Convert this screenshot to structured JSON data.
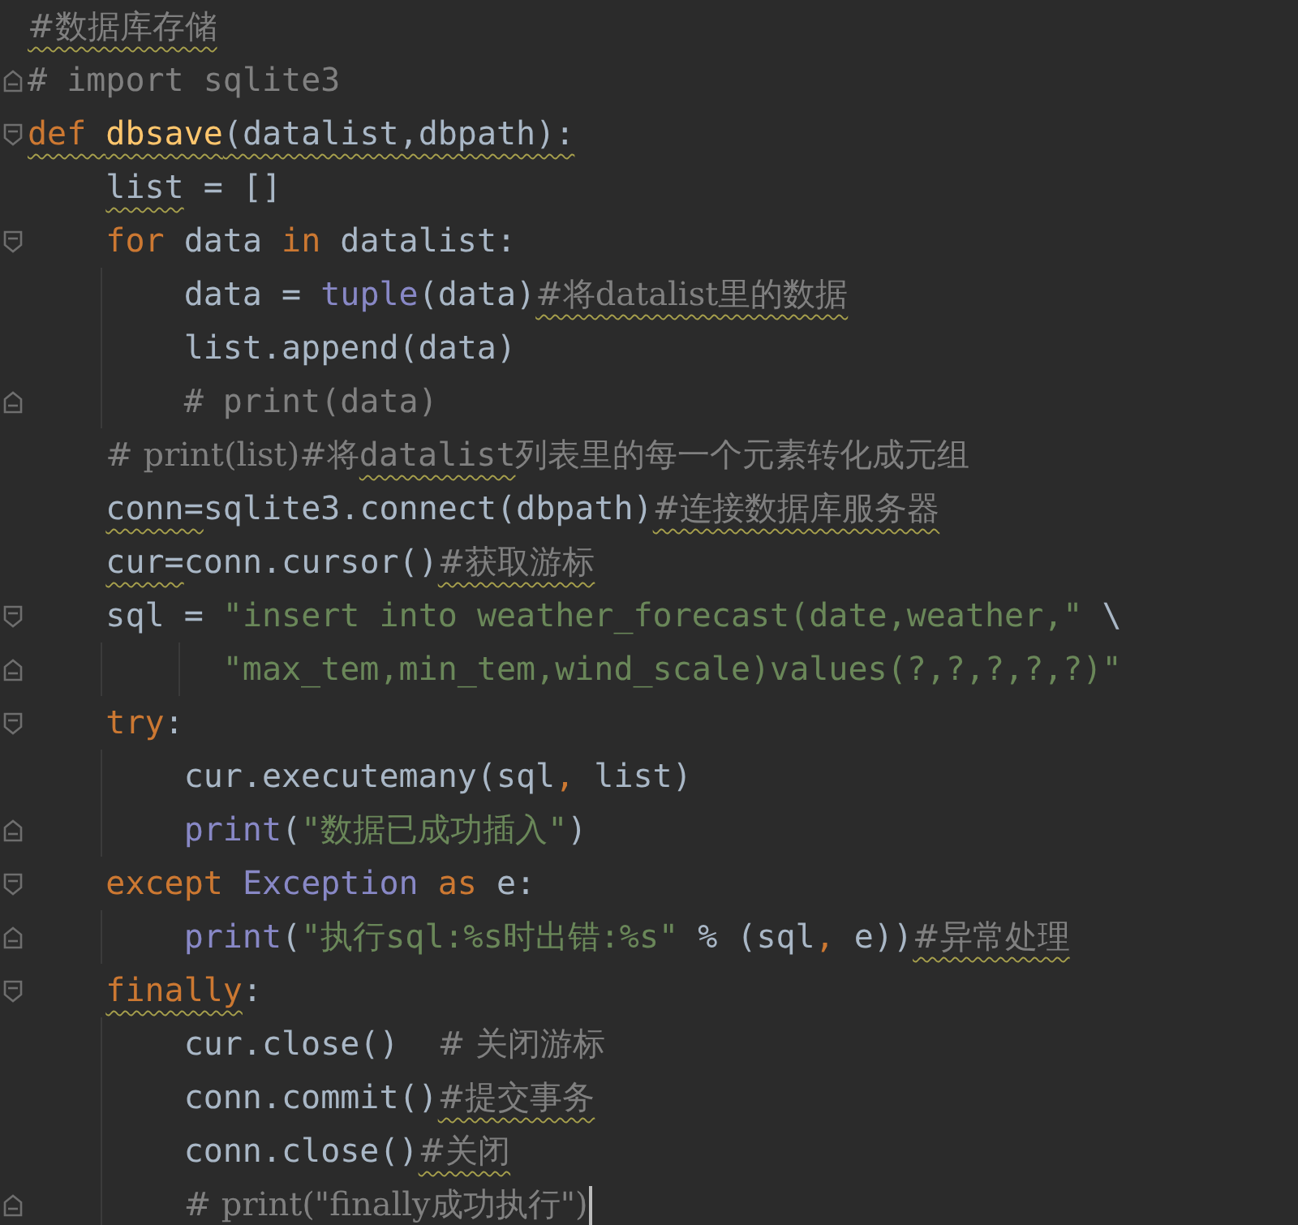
{
  "editor": {
    "lines": [
      {
        "fold_open": false,
        "fold_close": false,
        "tokens": [
          {
            "text": "#数据库存储",
            "kind": "comment",
            "typo": true
          }
        ]
      },
      {
        "fold_open": false,
        "fold_close": true,
        "tokens": [
          {
            "text": "# import sqlite3",
            "kind": "comment"
          }
        ]
      },
      {
        "fold_open": true,
        "fold_close": false,
        "tokens": [
          {
            "text": "def ",
            "kind": "keyword",
            "typo": true
          },
          {
            "text": "dbsave",
            "kind": "function",
            "typo": true
          },
          {
            "text": "(datalist,dbpath):",
            "kind": "plain",
            "typo": true
          }
        ]
      },
      {
        "fold_open": false,
        "fold_close": false,
        "tokens": [
          {
            "text": "    list",
            "kind": "plain",
            "typo": true
          },
          {
            "text": " = []",
            "kind": "plain"
          }
        ]
      },
      {
        "fold_open": true,
        "fold_close": false,
        "tokens": [
          {
            "text": "    for",
            "kind": "keyword"
          },
          {
            "text": " data ",
            "kind": "plain"
          },
          {
            "text": "in",
            "kind": "keyword"
          },
          {
            "text": " datalist:",
            "kind": "plain"
          }
        ]
      },
      {
        "fold_open": false,
        "fold_close": false,
        "tokens": [
          {
            "text": "        data = ",
            "kind": "plain"
          },
          {
            "text": "tuple",
            "kind": "builtin"
          },
          {
            "text": "(data)",
            "kind": "plain"
          },
          {
            "text": "#将datalist里的数据",
            "kind": "comment",
            "typo": true
          }
        ]
      },
      {
        "fold_open": false,
        "fold_close": false,
        "tokens": [
          {
            "text": "        list.append(data)",
            "kind": "plain"
          }
        ]
      },
      {
        "fold_open": false,
        "fold_close": true,
        "tokens": [
          {
            "text": "        # print(data)",
            "kind": "comment"
          }
        ]
      },
      {
        "fold_open": false,
        "fold_close": false,
        "tokens": [
          {
            "text": "    # print(list)#将",
            "kind": "comment"
          },
          {
            "text": "datalist",
            "kind": "comment",
            "typo": true
          },
          {
            "text": "列表里的每一个元素转化成元组",
            "kind": "comment"
          }
        ]
      },
      {
        "fold_open": false,
        "fold_close": false,
        "tokens": [
          {
            "text": "    conn=",
            "kind": "plain",
            "typo": true
          },
          {
            "text": "sqlite3.connect(dbpath)",
            "kind": "plain"
          },
          {
            "text": "#连接数据库服务器",
            "kind": "comment",
            "typo": true
          }
        ]
      },
      {
        "fold_open": false,
        "fold_close": false,
        "tokens": [
          {
            "text": "    cur=",
            "kind": "plain",
            "typo": true
          },
          {
            "text": "conn.cursor()",
            "kind": "plain"
          },
          {
            "text": "#获取游标",
            "kind": "comment",
            "typo": true
          }
        ]
      },
      {
        "fold_open": true,
        "fold_close": false,
        "tokens": [
          {
            "text": "    sql = ",
            "kind": "plain"
          },
          {
            "text": "\"insert into weather_forecast(date,weather,\"",
            "kind": "string"
          },
          {
            "text": " \\",
            "kind": "plain"
          }
        ]
      },
      {
        "fold_open": false,
        "fold_close": true,
        "tokens": [
          {
            "text": "          \"max_tem,min_tem,wind_scale)values(?,?,?,?,?)\"",
            "kind": "string"
          }
        ]
      },
      {
        "fold_open": true,
        "fold_close": false,
        "tokens": [
          {
            "text": "    try",
            "kind": "keyword"
          },
          {
            "text": ":",
            "kind": "plain"
          }
        ]
      },
      {
        "fold_open": false,
        "fold_close": false,
        "tokens": [
          {
            "text": "        cur.executemany(sql",
            "kind": "plain"
          },
          {
            "text": ",",
            "kind": "keyword"
          },
          {
            "text": " list)",
            "kind": "plain"
          }
        ]
      },
      {
        "fold_open": false,
        "fold_close": true,
        "tokens": [
          {
            "text": "        print",
            "kind": "builtin"
          },
          {
            "text": "(",
            "kind": "plain"
          },
          {
            "text": "\"数据已成功插入\"",
            "kind": "string"
          },
          {
            "text": ")",
            "kind": "plain"
          }
        ]
      },
      {
        "fold_open": true,
        "fold_close": false,
        "tokens": [
          {
            "text": "    except ",
            "kind": "keyword"
          },
          {
            "text": "Exception",
            "kind": "builtin"
          },
          {
            "text": " as",
            "kind": "keyword"
          },
          {
            "text": " e:",
            "kind": "plain"
          }
        ]
      },
      {
        "fold_open": false,
        "fold_close": true,
        "tokens": [
          {
            "text": "        print",
            "kind": "builtin"
          },
          {
            "text": "(",
            "kind": "plain"
          },
          {
            "text": "\"执行sql:%s时出错:%s\"",
            "kind": "string"
          },
          {
            "text": " % (sql",
            "kind": "plain"
          },
          {
            "text": ",",
            "kind": "keyword"
          },
          {
            "text": " e))",
            "kind": "plain"
          },
          {
            "text": "#异常处理",
            "kind": "comment",
            "typo": true
          }
        ]
      },
      {
        "fold_open": true,
        "fold_close": false,
        "tokens": [
          {
            "text": "    finally",
            "kind": "keyword",
            "typo": true
          },
          {
            "text": ":",
            "kind": "plain"
          }
        ]
      },
      {
        "fold_open": false,
        "fold_close": false,
        "tokens": [
          {
            "text": "        cur.close()  ",
            "kind": "plain"
          },
          {
            "text": "# 关闭游标",
            "kind": "comment"
          }
        ]
      },
      {
        "fold_open": false,
        "fold_close": false,
        "tokens": [
          {
            "text": "        conn.commit()",
            "kind": "plain"
          },
          {
            "text": "#提交事务",
            "kind": "comment",
            "typo": true
          }
        ]
      },
      {
        "fold_open": false,
        "fold_close": false,
        "tokens": [
          {
            "text": "        conn.close()",
            "kind": "plain"
          },
          {
            "text": "#关闭",
            "kind": "comment",
            "typo": true
          }
        ]
      },
      {
        "fold_open": false,
        "fold_close": true,
        "caret": true,
        "tokens": [
          {
            "text": "        # print(\"finally成功执行\")",
            "kind": "comment"
          }
        ]
      }
    ]
  }
}
